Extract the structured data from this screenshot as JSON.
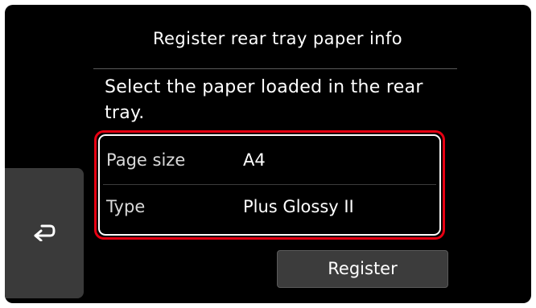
{
  "header": {
    "title": "Register rear tray paper info"
  },
  "instruction": "Select the paper loaded in the rear tray.",
  "settings": [
    {
      "label": "Page size",
      "value": "A4"
    },
    {
      "label": "Type",
      "value": "Plus Glossy II"
    }
  ],
  "actions": {
    "register_label": "Register",
    "back_icon": "back-arrow-icon"
  },
  "colors": {
    "screen_background": "#000000",
    "highlight_frame": "#e60012",
    "button_background": "#3c3c3c",
    "text": "#ffffff"
  }
}
